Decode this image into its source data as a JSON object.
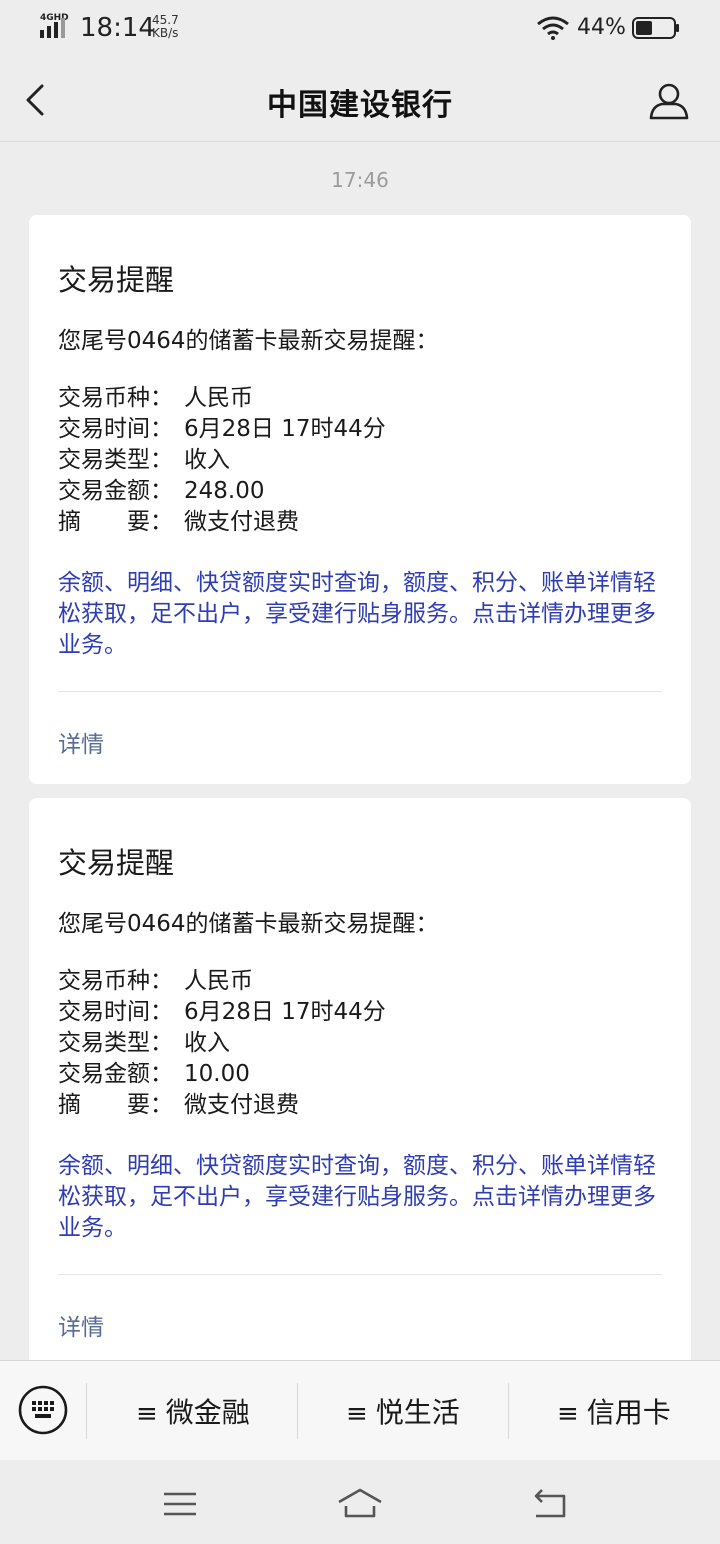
{
  "status_bar": {
    "network": "4GHD",
    "time": "18:14",
    "speed_value": "45.7",
    "speed_unit": "KB/s",
    "battery_percent": "44%",
    "battery_level": 0.44
  },
  "nav": {
    "title": "中国建设银行",
    "back_icon": "chevron-left-icon",
    "user_icon": "user-icon"
  },
  "timestamp": "17:46",
  "messages": [
    {
      "title": "交易提醒",
      "intro": "您尾号0464的储蓄卡最新交易提醒：",
      "fields": [
        {
          "label": "交易币种：",
          "value": "人民币"
        },
        {
          "label": "交易时间：",
          "value": "6月28日 17时44分"
        },
        {
          "label": "交易类型：",
          "value": "收入"
        },
        {
          "label": "交易金额：",
          "value": "248.00"
        },
        {
          "label": "摘　　要：",
          "value": "微支付退费"
        }
      ],
      "promo": "余额、明细、快贷额度实时查询，额度、积分、账单详情轻松获取，足不出户，享受建行贴身服务。点击详情办理更多业务。",
      "link": "详情"
    },
    {
      "title": "交易提醒",
      "intro": "您尾号0464的储蓄卡最新交易提醒：",
      "fields": [
        {
          "label": "交易币种：",
          "value": "人民币"
        },
        {
          "label": "交易时间：",
          "value": "6月28日 17时44分"
        },
        {
          "label": "交易类型：",
          "value": "收入"
        },
        {
          "label": "交易金额：",
          "value": "10.00"
        },
        {
          "label": "摘　　要：",
          "value": "微支付退费"
        }
      ],
      "promo": "余额、明细、快贷额度实时查询，额度、积分、账单详情轻松获取，足不出户，享受建行贴身服务。点击详情办理更多业务。",
      "link": "详情"
    }
  ],
  "menu": {
    "keyboard_icon": "keyboard-icon",
    "items": [
      {
        "glyph": "≡",
        "label": "微金融"
      },
      {
        "glyph": "≡",
        "label": "悦生活"
      },
      {
        "glyph": "≡",
        "label": "信用卡"
      }
    ]
  },
  "system_nav": {
    "menu_icon": "menu-icon",
    "home_icon": "home-icon",
    "back_icon": "back-icon"
  },
  "colors": {
    "background": "#ededed",
    "card": "#ffffff",
    "promo_text": "#2f3db5",
    "link_text": "#576b95",
    "timestamp": "#9b9b9b"
  }
}
